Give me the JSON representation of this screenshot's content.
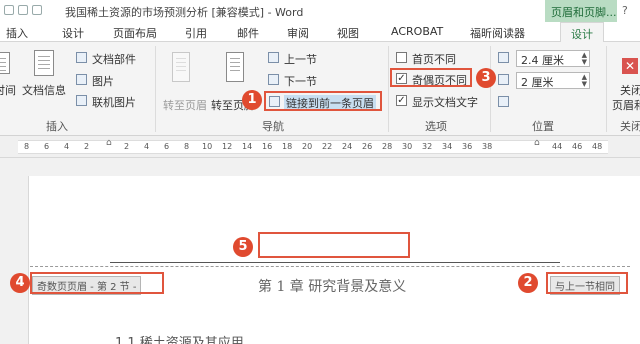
{
  "window": {
    "title": "我国稀土资源的市场预测分析 [兼容模式] - Word",
    "context_tab_label": "页眉和页脚...",
    "right_cut": "?"
  },
  "tabs": [
    {
      "label": "插入"
    },
    {
      "label": "设计"
    },
    {
      "label": "页面布局"
    },
    {
      "label": "引用"
    },
    {
      "label": "邮件"
    },
    {
      "label": "审阅"
    },
    {
      "label": "视图"
    },
    {
      "label": "ACROBAT"
    },
    {
      "label": "福昕阅读器"
    },
    {
      "label": "设计"
    }
  ],
  "ribbon": {
    "insert_group": {
      "date_time": "时间",
      "doc_info": "文档信息",
      "doc_parts": "文档部件",
      "picture": "图片",
      "online_picture": "联机图片",
      "group_label": "插入"
    },
    "nav_group": {
      "goto_header": "转至页眉",
      "goto_footer": "转至页脚",
      "prev_section": "上一节",
      "next_section": "下一节",
      "link_to_previous": "链接到前一条页眉",
      "group_label": "导航"
    },
    "options_group": {
      "different_first_page": {
        "label": "首页不同",
        "checked": false
      },
      "different_odd_even": {
        "label": "奇偶页不同",
        "checked": true
      },
      "show_doc_text": {
        "label": "显示文档文字",
        "checked": true
      },
      "group_label": "选项"
    },
    "position_group": {
      "header_from_top": "2.4 厘米",
      "footer_from_bottom": "2 厘米",
      "group_label": "位置"
    },
    "close_group": {
      "close_label_1": "关闭",
      "close_label_2": "页眉和页",
      "group_label": "关闭"
    }
  },
  "ruler": {
    "numbers": [
      "8",
      "6",
      "4",
      "2",
      "",
      "2",
      "4",
      "6",
      "8",
      "10",
      "12",
      "14",
      "16",
      "18",
      "20",
      "22",
      "24",
      "26",
      "28",
      "30",
      "32",
      "34",
      "36",
      "38",
      "",
      "42",
      "44",
      "46",
      "48"
    ]
  },
  "document": {
    "header_tag_left": "奇数页页眉 - 第 2 节 -",
    "header_tag_right": "与上一节相同",
    "chapter_title": "第 1 章  研究背景及意义",
    "subheading": "1.1 稀土资源及其应用"
  },
  "callouts": [
    "1",
    "2",
    "3",
    "4",
    "5"
  ],
  "colors": {
    "accent_green": "#2a7a45",
    "callout_red": "#e0553d",
    "ribbon_bg": "#f4f4f4"
  }
}
